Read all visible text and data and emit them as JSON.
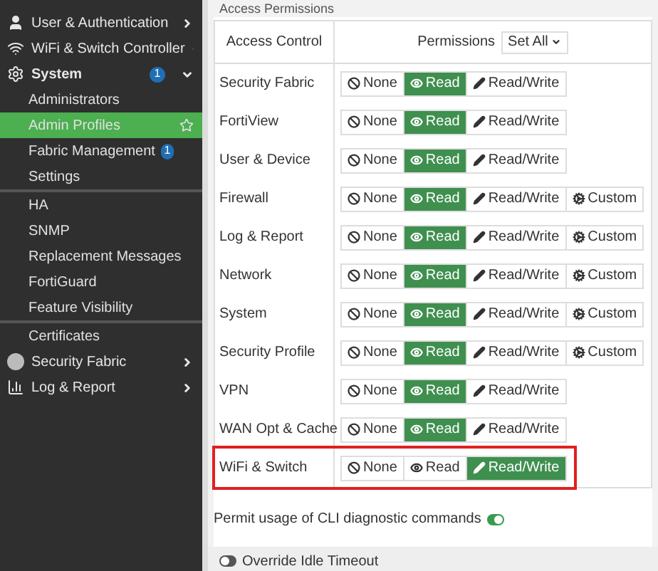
{
  "sidebar": {
    "items": [
      {
        "label": "User & Authentication",
        "kind": "section",
        "expanded": false
      },
      {
        "label": "WiFi & Switch Controller",
        "kind": "section",
        "expanded": false
      },
      {
        "label": "System",
        "kind": "section",
        "expanded": true,
        "badge": "1"
      },
      {
        "label": "Administrators",
        "kind": "sub",
        "selected": false
      },
      {
        "label": "Admin Profiles",
        "kind": "sub",
        "selected": true,
        "favorite": true
      },
      {
        "label": "Fabric Management",
        "kind": "sub",
        "selected": false,
        "badge": "1"
      },
      {
        "label": "Settings",
        "kind": "sub",
        "selected": false,
        "divider": true
      },
      {
        "label": "HA",
        "kind": "sub",
        "selected": false
      },
      {
        "label": "SNMP",
        "kind": "sub",
        "selected": false
      },
      {
        "label": "Replacement Messages",
        "kind": "sub",
        "selected": false
      },
      {
        "label": "FortiGuard",
        "kind": "sub",
        "selected": false
      },
      {
        "label": "Feature Visibility",
        "kind": "sub",
        "selected": false,
        "divider": true
      },
      {
        "label": "Certificates",
        "kind": "sub",
        "selected": false
      },
      {
        "label": "Security Fabric",
        "kind": "section",
        "expanded": false
      },
      {
        "label": "Log & Report",
        "kind": "section",
        "expanded": false
      }
    ]
  },
  "section_title": "Access Permissions",
  "table": {
    "columns": [
      "Access Control",
      "Permissions"
    ],
    "set_all": "Set All",
    "rows": [
      {
        "name": "Security Fabric",
        "highlighted": false,
        "options": [
          {
            "kind": "none",
            "label": "None",
            "selected": false
          },
          {
            "kind": "read",
            "label": "Read",
            "selected": true
          },
          {
            "kind": "write",
            "label": "Read/Write",
            "selected": false
          }
        ]
      },
      {
        "name": "FortiView",
        "highlighted": false,
        "options": [
          {
            "kind": "none",
            "label": "None",
            "selected": false
          },
          {
            "kind": "read",
            "label": "Read",
            "selected": true
          },
          {
            "kind": "write",
            "label": "Read/Write",
            "selected": false
          }
        ]
      },
      {
        "name": "User & Device",
        "highlighted": false,
        "options": [
          {
            "kind": "none",
            "label": "None",
            "selected": false
          },
          {
            "kind": "read",
            "label": "Read",
            "selected": true
          },
          {
            "kind": "write",
            "label": "Read/Write",
            "selected": false
          }
        ]
      },
      {
        "name": "Firewall",
        "highlighted": false,
        "options": [
          {
            "kind": "none",
            "label": "None",
            "selected": false
          },
          {
            "kind": "read",
            "label": "Read",
            "selected": true
          },
          {
            "kind": "write",
            "label": "Read/Write",
            "selected": false
          },
          {
            "kind": "custom",
            "label": "Custom",
            "selected": false
          }
        ]
      },
      {
        "name": "Log & Report",
        "highlighted": false,
        "options": [
          {
            "kind": "none",
            "label": "None",
            "selected": false
          },
          {
            "kind": "read",
            "label": "Read",
            "selected": true
          },
          {
            "kind": "write",
            "label": "Read/Write",
            "selected": false
          },
          {
            "kind": "custom",
            "label": "Custom",
            "selected": false
          }
        ]
      },
      {
        "name": "Network",
        "highlighted": false,
        "options": [
          {
            "kind": "none",
            "label": "None",
            "selected": false
          },
          {
            "kind": "read",
            "label": "Read",
            "selected": true
          },
          {
            "kind": "write",
            "label": "Read/Write",
            "selected": false
          },
          {
            "kind": "custom",
            "label": "Custom",
            "selected": false
          }
        ]
      },
      {
        "name": "System",
        "highlighted": false,
        "options": [
          {
            "kind": "none",
            "label": "None",
            "selected": false
          },
          {
            "kind": "read",
            "label": "Read",
            "selected": true
          },
          {
            "kind": "write",
            "label": "Read/Write",
            "selected": false
          },
          {
            "kind": "custom",
            "label": "Custom",
            "selected": false
          }
        ]
      },
      {
        "name": "Security Profile",
        "highlighted": false,
        "options": [
          {
            "kind": "none",
            "label": "None",
            "selected": false
          },
          {
            "kind": "read",
            "label": "Read",
            "selected": true
          },
          {
            "kind": "write",
            "label": "Read/Write",
            "selected": false
          },
          {
            "kind": "custom",
            "label": "Custom",
            "selected": false
          }
        ]
      },
      {
        "name": "VPN",
        "highlighted": false,
        "options": [
          {
            "kind": "none",
            "label": "None",
            "selected": false
          },
          {
            "kind": "read",
            "label": "Read",
            "selected": true
          },
          {
            "kind": "write",
            "label": "Read/Write",
            "selected": false
          }
        ]
      },
      {
        "name": "WAN Opt & Cache",
        "highlighted": false,
        "options": [
          {
            "kind": "none",
            "label": "None",
            "selected": false
          },
          {
            "kind": "read",
            "label": "Read",
            "selected": true
          },
          {
            "kind": "write",
            "label": "Read/Write",
            "selected": false
          }
        ]
      },
      {
        "name": "WiFi & Switch",
        "highlighted": true,
        "options": [
          {
            "kind": "none",
            "label": "None",
            "selected": false
          },
          {
            "kind": "read",
            "label": "Read",
            "selected": false
          },
          {
            "kind": "write",
            "label": "Read/Write",
            "selected": true
          }
        ]
      }
    ]
  },
  "cli_toggle": {
    "label": "Permit usage of CLI diagnostic commands",
    "on": true
  },
  "idle_toggle": {
    "label": "Override Idle Timeout",
    "on": false
  }
}
